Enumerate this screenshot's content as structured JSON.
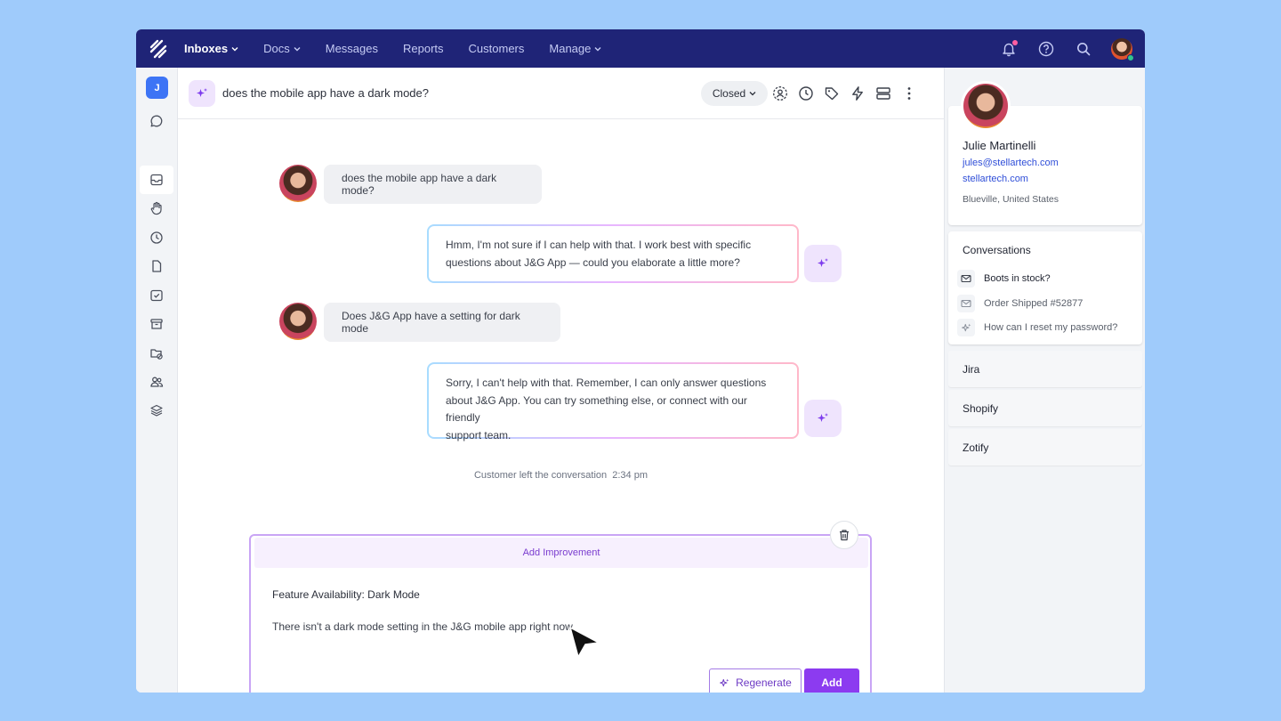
{
  "nav": {
    "items": [
      {
        "label": "Inboxes",
        "has_dropdown": true,
        "active": true
      },
      {
        "label": "Docs",
        "has_dropdown": true,
        "active": false
      },
      {
        "label": "Messages",
        "has_dropdown": false,
        "active": false
      },
      {
        "label": "Reports",
        "has_dropdown": false,
        "active": false
      },
      {
        "label": "Customers",
        "has_dropdown": false,
        "active": false
      },
      {
        "label": "Manage",
        "has_dropdown": true,
        "active": false
      }
    ],
    "right_icons": [
      "bell-icon",
      "help-icon",
      "search-icon",
      "user-avatar"
    ]
  },
  "rail": {
    "workspace_initial": "J",
    "icons": [
      "chat-icon",
      "inbox-icon",
      "hand-icon",
      "clock-icon",
      "document-icon",
      "check-inbox-icon",
      "archive-icon",
      "folder-block-icon",
      "users-icon",
      "layers-icon"
    ]
  },
  "conversation": {
    "title": "does the mobile app have a dark mode?",
    "status": "Closed",
    "toolbar_icons": [
      "assign-icon",
      "snooze-clock-icon",
      "tag-icon",
      "bolt-icon",
      "layout-icon",
      "more-icon"
    ],
    "messages": [
      {
        "from": "customer",
        "text": "does the mobile app have a dark mode?"
      },
      {
        "from": "bot",
        "lines": [
          "Hmm, I'm not sure if I can help with that. I work best with specific",
          "questions about J&G App — could you elaborate a little more?"
        ]
      },
      {
        "from": "customer",
        "text": "Does J&G App have a setting for dark mode"
      },
      {
        "from": "bot",
        "lines": [
          "Sorry, I can't help with that. Remember, I can only answer questions",
          "about J&G App. You can try something else, or connect with our friendly",
          "support team."
        ]
      }
    ],
    "system_message": "Customer left the conversation  2:34 pm"
  },
  "improvement": {
    "header": "Add Improvement",
    "title": "Feature Availability: Dark Mode",
    "body": "There isn't a dark mode setting in the J&G mobile app right now.",
    "regenerate_label": "Regenerate",
    "add_label": "Add"
  },
  "customer": {
    "name": "Julie Martinelli",
    "email": "jules@stellartech.com",
    "website": "stellartech.com",
    "location": "Blueville, United States"
  },
  "conversations_panel": {
    "title": "Conversations",
    "items": [
      {
        "label": "Boots in stock?",
        "icon": "mail-icon"
      },
      {
        "label": "Order Shipped #52877",
        "icon": "mail-icon"
      },
      {
        "label": "How can I reset my password?",
        "icon": "sparkle-icon"
      }
    ]
  },
  "integrations": [
    "Jira",
    "Shopify",
    "Zotify"
  ],
  "colors": {
    "nav_bg": "#1f2477",
    "accent_purple": "#8c3bf0",
    "link_blue": "#2f4ed8",
    "page_bg": "#9fcbfb"
  }
}
